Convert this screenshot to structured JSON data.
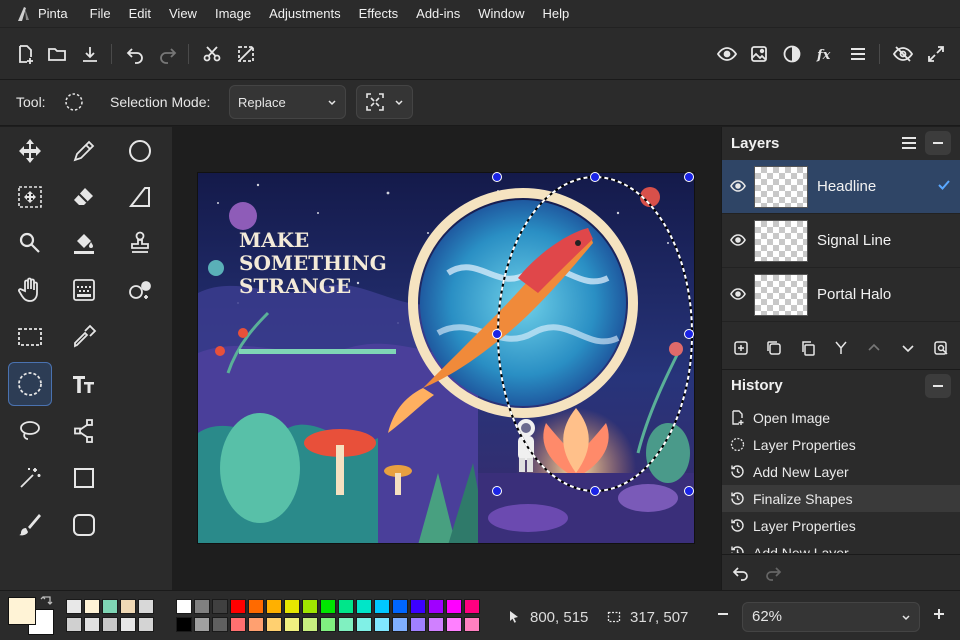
{
  "app": {
    "name": "Pinta"
  },
  "menu": [
    "File",
    "Edit",
    "View",
    "Image",
    "Adjustments",
    "Effects",
    "Add-ins",
    "Window",
    "Help"
  ],
  "tool_options": {
    "tool_label": "Tool:",
    "selection_mode_label": "Selection Mode:",
    "selection_mode_value": "Replace"
  },
  "artwork": {
    "headline_lines": [
      "MAKE",
      "SOMETHING",
      "STRANGE"
    ]
  },
  "layers": {
    "title": "Layers",
    "items": [
      {
        "name": "Headline",
        "selected": true
      },
      {
        "name": "Signal Line",
        "selected": false
      },
      {
        "name": "Portal Halo",
        "selected": false
      }
    ]
  },
  "history": {
    "title": "History",
    "items": [
      {
        "label": "Open Image",
        "icon": "open-image-icon"
      },
      {
        "label": "Layer Properties",
        "icon": "layer-properties-icon"
      },
      {
        "label": "Add New Layer",
        "icon": "history-icon"
      },
      {
        "label": "Finalize Shapes",
        "icon": "history-icon",
        "current": true
      },
      {
        "label": "Layer Properties",
        "icon": "history-icon"
      },
      {
        "label": "Add New Layer",
        "icon": "history-icon"
      }
    ]
  },
  "status": {
    "cursor_position": "800, 515",
    "selection_size": "317, 507",
    "zoom": "62%"
  },
  "colors": {
    "primary": "#fff3d6",
    "secondary": "#ffffff",
    "accent": "#4a72b0",
    "selection_handle": "#1a23e6",
    "palette_row1": [
      "#ffffff",
      "#808080",
      "#404040",
      "#ff0000",
      "#ff6a00",
      "#ffb000",
      "#e6e600",
      "#a0e600",
      "#00e600",
      "#00e68a",
      "#00e6c8",
      "#00c8ff",
      "#0066ff",
      "#3c00ff",
      "#a000ff",
      "#ff00ff",
      "#ff0080"
    ],
    "palette_row2": [
      "#000000",
      "#a0a0a0",
      "#606060",
      "#ff7070",
      "#ffa070",
      "#ffd070",
      "#f0f080",
      "#c8f080",
      "#80f080",
      "#80f0c0",
      "#80f0e6",
      "#80e6ff",
      "#80b0ff",
      "#a080ff",
      "#d080ff",
      "#ff80ff",
      "#ff80c0"
    ],
    "recent_row1": [
      "#e8e8e8",
      "#fff3d6",
      "#7fd6b5",
      "#f0d9b5",
      "#d8d8d8"
    ],
    "recent_row2": [
      "#d0d0d0",
      "#e0e0e0",
      "#c8c8c8",
      "#e6e6e6",
      "#d4d4d4"
    ]
  }
}
